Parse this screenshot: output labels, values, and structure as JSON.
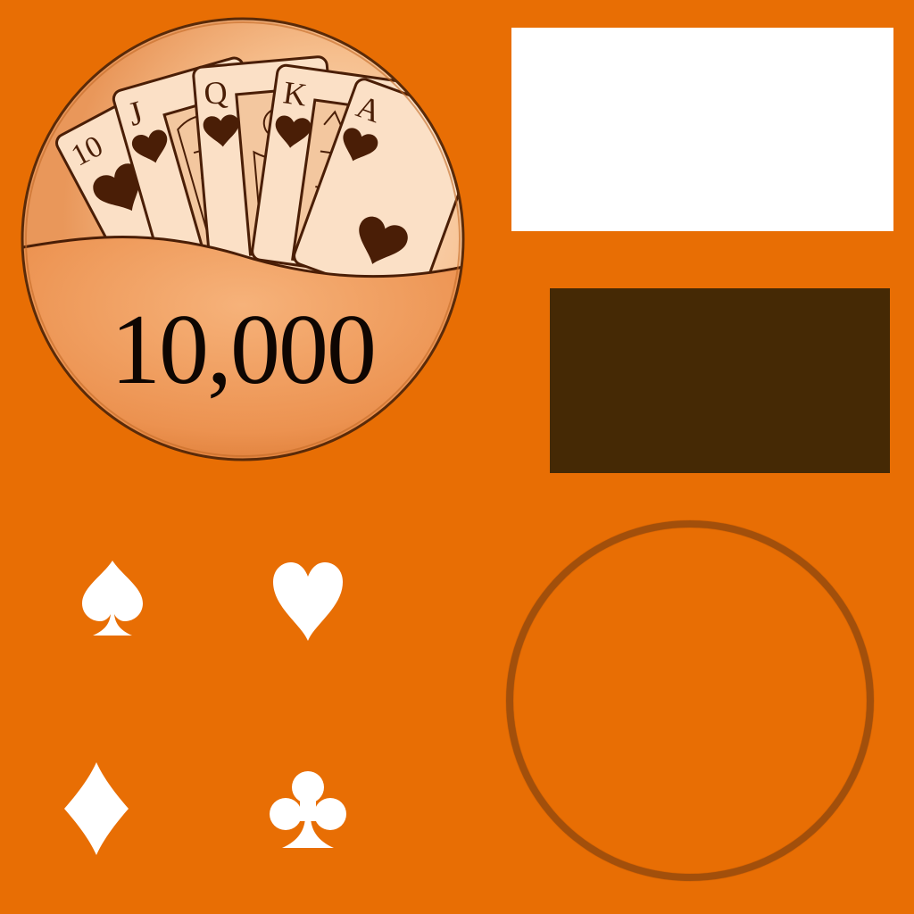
{
  "chip": {
    "value_label": "10,000",
    "card_ranks": [
      "10",
      "J",
      "Q",
      "K",
      "A"
    ],
    "suit_pictured": "heart-icon"
  },
  "colors": {
    "background": "#e86e04",
    "chip_outline": "#5a2a08",
    "card_ink": "#4a1e06",
    "white_panel": "#ffffff",
    "dark_panel": "#452905",
    "ring": "#a24f0b",
    "suit_symbols": "#ffffff"
  },
  "suits": [
    "spade-icon",
    "heart-icon",
    "diamond-icon",
    "club-icon"
  ]
}
